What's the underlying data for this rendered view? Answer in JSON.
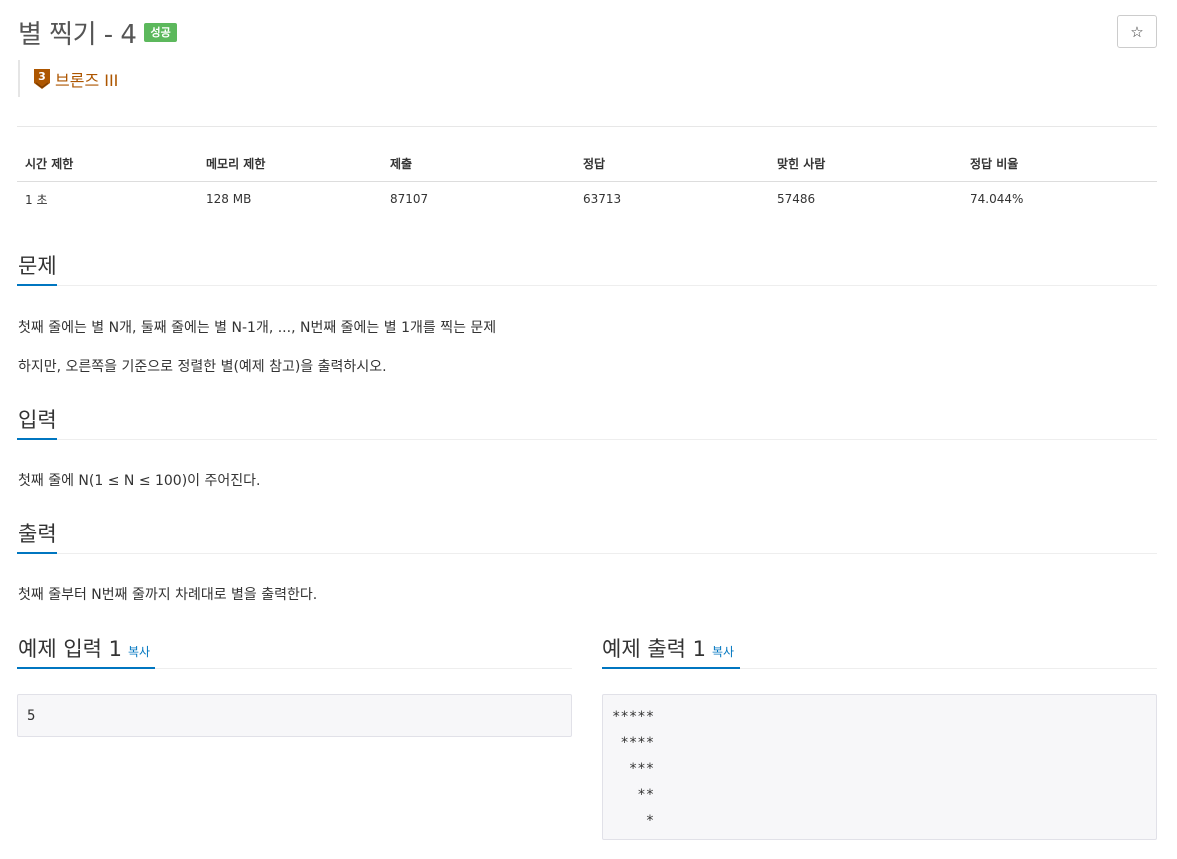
{
  "problem": {
    "title": "별 찍기 - 4",
    "status_badge": "성공",
    "star_icon": "☆",
    "tier": {
      "number": "3",
      "label": "브론즈 III",
      "color": "#ad5600"
    }
  },
  "info_table": {
    "headers": [
      "시간 제한",
      "메모리 제한",
      "제출",
      "정답",
      "맞힌 사람",
      "정답 비율"
    ],
    "values": [
      "1 초",
      "128 MB",
      "87107",
      "63713",
      "57486",
      "74.044%"
    ]
  },
  "sections": {
    "description": {
      "heading": "문제",
      "lines": [
        "첫째 줄에는 별 N개, 둘째 줄에는 별 N-1개, ..., N번째 줄에는 별 1개를 찍는 문제",
        "하지만, 오른쪽을 기준으로 정렬한 별(예제 참고)을 출력하시오."
      ]
    },
    "input": {
      "heading": "입력",
      "text": "첫째 줄에 N(1 ≤ N ≤ 100)이 주어진다."
    },
    "output": {
      "heading": "출력",
      "text": "첫째 줄부터 N번째 줄까지 차례대로 별을 출력한다."
    }
  },
  "samples": {
    "input": {
      "heading": "예제 입력 1",
      "copy_label": "복사",
      "lines": [
        "5"
      ]
    },
    "output": {
      "heading": "예제 출력 1",
      "copy_label": "복사",
      "lines": [
        "*****",
        " ****",
        "  ***",
        "   **",
        "    *"
      ]
    }
  },
  "colors": {
    "accent": "#0076c0",
    "success": "#5cb85c"
  }
}
